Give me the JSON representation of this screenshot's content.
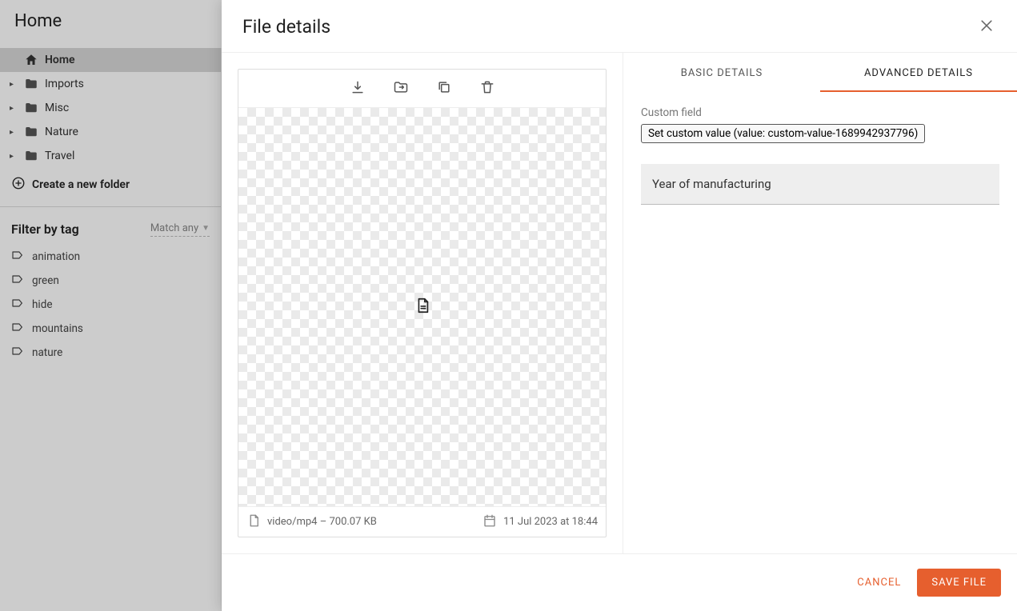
{
  "app": {
    "title": "Home"
  },
  "sidebar": {
    "items": [
      {
        "label": "Home",
        "icon": "home-icon",
        "active": true,
        "expandable": false
      },
      {
        "label": "Imports",
        "icon": "folder-icon",
        "active": false,
        "expandable": true
      },
      {
        "label": "Misc",
        "icon": "folder-icon",
        "active": false,
        "expandable": true
      },
      {
        "label": "Nature",
        "icon": "folder-icon",
        "active": false,
        "expandable": true
      },
      {
        "label": "Travel",
        "icon": "folder-icon",
        "active": false,
        "expandable": true
      }
    ],
    "create_label": "Create a new folder"
  },
  "filter": {
    "title": "Filter by tag",
    "match_label": "Match any",
    "tags": [
      {
        "label": "animation"
      },
      {
        "label": "green"
      },
      {
        "label": "hide"
      },
      {
        "label": "mountains"
      },
      {
        "label": "nature"
      }
    ]
  },
  "modal": {
    "title": "File details",
    "tabs": {
      "basic": "BASIC DETAILS",
      "advanced": "ADVANCED DETAILS",
      "active": "advanced"
    },
    "preview": {
      "mime": "video/mp4",
      "size": "700.07 KB",
      "sep": " – ",
      "date": "11 Jul 2023 at 18:44"
    },
    "details": {
      "custom_field_label": "Custom field",
      "custom_field_button": "Set custom value (value: custom-value-1689942937796)",
      "year_label": "Year of manufacturing"
    },
    "footer": {
      "cancel": "CANCEL",
      "save": "SAVE FILE"
    }
  }
}
